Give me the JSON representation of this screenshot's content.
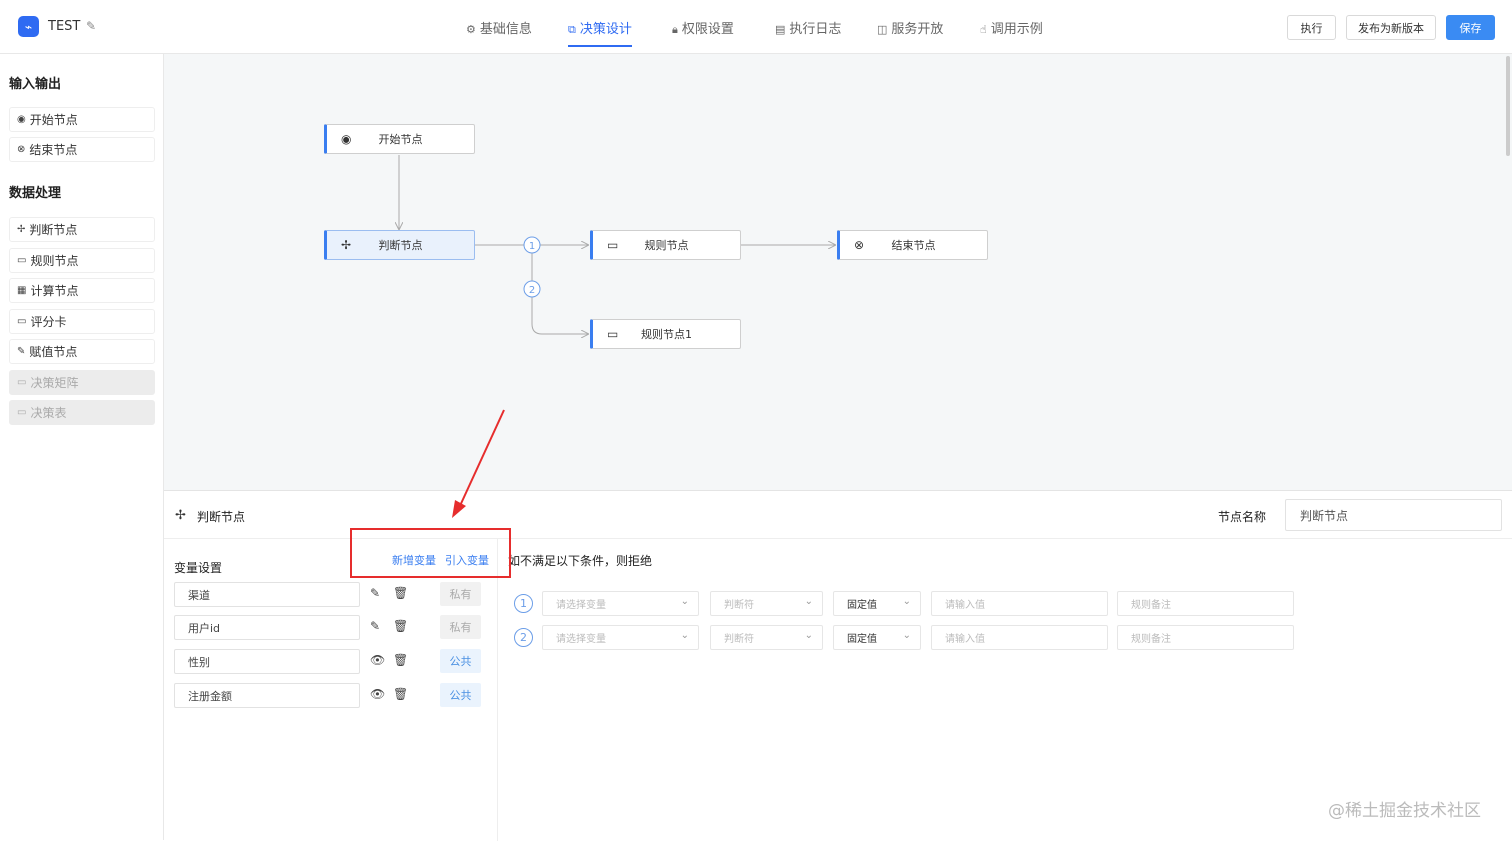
{
  "app": {
    "title": "TEST",
    "logo_icon": "logo-icon"
  },
  "nav": {
    "tabs": [
      {
        "label": "基础信息",
        "icon": "gear-icon"
      },
      {
        "label": "决策设计",
        "icon": "design-icon",
        "active": true
      },
      {
        "label": "权限设置",
        "icon": "lock-icon"
      },
      {
        "label": "执行日志",
        "icon": "document-icon"
      },
      {
        "label": "服务开放",
        "icon": "book-icon"
      },
      {
        "label": "调用示例",
        "icon": "hand-icon"
      }
    ]
  },
  "toolbar": {
    "run_label": "执行",
    "publish_label": "发布为新版本",
    "save_label": "保存"
  },
  "sidebar": {
    "section1_title": "输入输出",
    "io_items": [
      "开始节点",
      "结束节点"
    ],
    "section2_title": "数据处理",
    "data_items": [
      "判断节点",
      "规则节点",
      "计算节点",
      "评分卡",
      "赋值节点",
      "决策矩阵",
      "决策表"
    ]
  },
  "flow": {
    "nodes": {
      "start": "开始节点",
      "judge": "判断节点",
      "rule": "规则节点",
      "end": "结束节点",
      "rule1": "规则节点1"
    },
    "branch_labels": [
      "1",
      "2"
    ]
  },
  "panel": {
    "node_type": "判断节点",
    "node_name_label": "节点名称",
    "node_name_value": "判断节点",
    "var_settings_title": "变量设置",
    "add_var_label": "新增变量",
    "import_var_label": "引入变量",
    "variables": [
      {
        "name": "渠道",
        "scope": "私有"
      },
      {
        "name": "用户id",
        "scope": "私有"
      },
      {
        "name": "性别",
        "scope": "公共"
      },
      {
        "name": "注册金额",
        "scope": "公共"
      }
    ],
    "condition_title": "如不满足以下条件，则拒绝",
    "conditions": [
      {
        "num": "1",
        "var_placeholder": "请选择变量",
        "op_placeholder": "判断符",
        "type": "固定值",
        "value_placeholder": "请输入值",
        "remark_placeholder": "规则备注"
      },
      {
        "num": "2",
        "var_placeholder": "请选择变量",
        "op_placeholder": "判断符",
        "type": "固定值",
        "value_placeholder": "请输入值",
        "remark_placeholder": "规则备注"
      }
    ]
  },
  "watermark": "@稀土掘金技术社区",
  "colors": {
    "accent": "#2f6bf2",
    "annotation": "#e62d2d"
  }
}
